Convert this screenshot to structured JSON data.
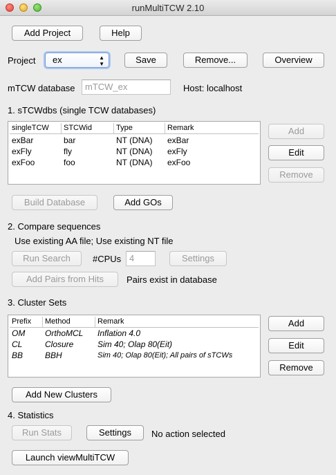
{
  "window": {
    "title": "runMultiTCW 2.10"
  },
  "top_buttons": {
    "add_project": "Add Project",
    "help": "Help"
  },
  "project": {
    "label": "Project",
    "selected": "ex",
    "save": "Save",
    "remove": "Remove...",
    "overview": "Overview"
  },
  "mtcw": {
    "label": "mTCW database",
    "value": "mTCW_ex",
    "host": "Host: localhost"
  },
  "stcw": {
    "section_title": "1. sTCWdbs (single TCW databases)",
    "columns": [
      "singleTCW",
      "STCWid",
      "Type",
      "Remark"
    ],
    "rows": [
      [
        "exBar",
        "bar",
        "NT (DNA)",
        "exBar"
      ],
      [
        "exFly",
        "fly",
        "NT (DNA)",
        "exFly"
      ],
      [
        "exFoo",
        "foo",
        "NT (DNA)",
        "exFoo"
      ]
    ],
    "add": "Add",
    "edit": "Edit",
    "remove": "Remove",
    "build_database": "Build Database",
    "add_gos": "Add GOs"
  },
  "compare": {
    "section_title": "2. Compare sequences",
    "status": "Use existing AA file; Use existing NT file",
    "run_search": "Run Search",
    "cpus_label": "#CPUs",
    "cpus_value": "4",
    "settings": "Settings",
    "add_pairs": "Add Pairs from Hits",
    "pairs_status": "Pairs exist in database"
  },
  "clusters": {
    "section_title": "3. Cluster Sets",
    "columns": [
      "Prefix",
      "Method",
      "Remark"
    ],
    "rows": [
      [
        "OM",
        "OrthoMCL",
        "Inflation 4.0"
      ],
      [
        "CL",
        "Closure",
        "Sim 40; Olap 80(Eit)"
      ],
      [
        "BB",
        "BBH",
        "Sim 40; Olap 80(Eit); All pairs of sTCWs"
      ]
    ],
    "add": "Add",
    "edit": "Edit",
    "remove": "Remove",
    "add_new": "Add New Clusters"
  },
  "stats": {
    "section_title": "4. Statistics",
    "run_stats": "Run Stats",
    "settings": "Settings",
    "status": "No action selected",
    "launch": "Launch viewMultiTCW"
  }
}
